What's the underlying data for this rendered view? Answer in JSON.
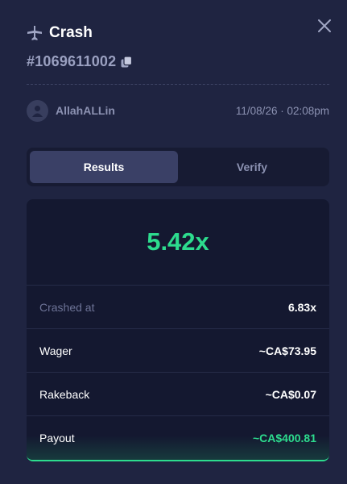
{
  "header": {
    "title": "Crash",
    "game_id": "#1069611002",
    "plane_icon": "plane-icon",
    "copy_icon": "copy-icon",
    "close_icon": "close-icon"
  },
  "player": {
    "username": "AllahALLin",
    "datetime": "11/08/26 · 02:08pm"
  },
  "tabs": [
    {
      "label": "Results",
      "active": true
    },
    {
      "label": "Verify",
      "active": false
    }
  ],
  "result": {
    "multiplier": "5.42x",
    "rows": [
      {
        "label": "Crashed at",
        "value": "6.83x"
      },
      {
        "label": "Wager",
        "value": "~CA$73.95"
      },
      {
        "label": "Rakeback",
        "value": "~CA$0.07"
      },
      {
        "label": "Payout",
        "value": "~CA$400.81"
      }
    ]
  },
  "colors": {
    "background": "#1f2441",
    "accent_green": "#2ddc8e",
    "muted_text": "#8c92b2"
  }
}
